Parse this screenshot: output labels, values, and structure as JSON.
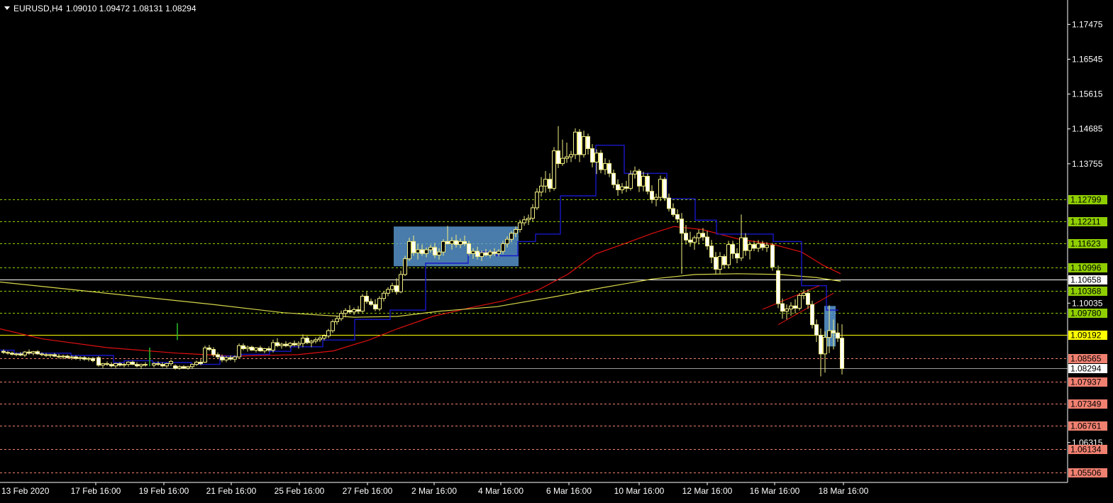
{
  "header": {
    "symbol_timeframe": "EURUSD,H4",
    "ohlc": "1.09010 1.09472 1.08131 1.08294",
    "dropdown_icon": "triangle-down-icon"
  },
  "colors": {
    "background": "#000000",
    "candle": "#f2ee82",
    "candle_body_bull": "#000000",
    "candle_body_bear": "#ffffff",
    "ma_fast": "#e01010",
    "ma_slow": "#d6d64a",
    "step_line": "#1818c8",
    "box": "#5b9bd5",
    "level_green": "#8fce00",
    "level_salmon": "#f08070",
    "level_yellow": "#ffff00",
    "level_white": "#ffffff",
    "axis": "#ffffff"
  },
  "chart_data": {
    "type": "candlestick",
    "title": "EURUSD,H4",
    "ylim": [
      1.0525,
      1.1805
    ],
    "y_ticks": [
      "1.17475",
      "1.16545",
      "1.15615",
      "1.14685",
      "1.13755",
      "1.10035",
      "1.06315"
    ],
    "x_ticks": [
      "13 Feb 2020",
      "17 Feb 16:00",
      "19 Feb 16:00",
      "21 Feb 16:00",
      "25 Feb 16:00",
      "27 Feb 16:00",
      "2 Mar 16:00",
      "4 Mar 16:00",
      "6 Mar 16:00",
      "10 Mar 16:00",
      "12 Mar 16:00",
      "16 Mar 16:00",
      "18 Mar 16:00"
    ],
    "levels": [
      {
        "value": "1.12799",
        "type": "green"
      },
      {
        "value": "1.12211",
        "type": "green"
      },
      {
        "value": "1.11623",
        "type": "green"
      },
      {
        "value": "1.10996",
        "type": "green"
      },
      {
        "value": "1.10658",
        "type": "white"
      },
      {
        "value": "1.10368",
        "type": "green"
      },
      {
        "value": "1.09780",
        "type": "green"
      },
      {
        "value": "1.09192",
        "type": "yellow"
      },
      {
        "value": "1.08565",
        "type": "salmon"
      },
      {
        "value": "1.08294",
        "type": "current"
      },
      {
        "value": "1.07937",
        "type": "salmon"
      },
      {
        "value": "1.07349",
        "type": "salmon"
      },
      {
        "value": "1.06761",
        "type": "salmon"
      },
      {
        "value": "1.06134",
        "type": "salmon"
      },
      {
        "value": "1.05506",
        "type": "salmon"
      }
    ]
  }
}
